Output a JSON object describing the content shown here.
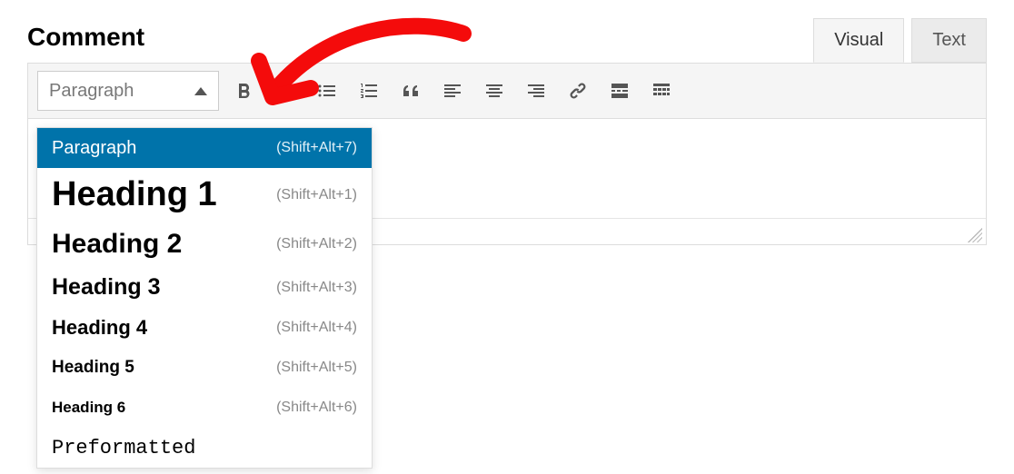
{
  "title": "Comment",
  "tabs": {
    "visual": "Visual",
    "text": "Text"
  },
  "format_selector": {
    "current": "Paragraph"
  },
  "toolbar_icons": {
    "bold": "bold-icon",
    "italic": "italic-icon",
    "ul": "bullet-list-icon",
    "ol": "numbered-list-icon",
    "quote": "blockquote-icon",
    "align_left": "align-left-icon",
    "align_center": "align-center-icon",
    "align_right": "align-right-icon",
    "link": "link-icon",
    "readmore": "read-more-icon",
    "toolbar_toggle": "toolbar-toggle-icon"
  },
  "dropdown": {
    "items": [
      {
        "label": "Paragraph",
        "shortcut": "(Shift+Alt+7)",
        "cls": "dd-paragraph",
        "selected": true,
        "name": "format-option-paragraph"
      },
      {
        "label": "Heading 1",
        "shortcut": "(Shift+Alt+1)",
        "cls": "dd-h1",
        "selected": false,
        "name": "format-option-heading-1"
      },
      {
        "label": "Heading 2",
        "shortcut": "(Shift+Alt+2)",
        "cls": "dd-h2",
        "selected": false,
        "name": "format-option-heading-2"
      },
      {
        "label": "Heading 3",
        "shortcut": "(Shift+Alt+3)",
        "cls": "dd-h3",
        "selected": false,
        "name": "format-option-heading-3"
      },
      {
        "label": "Heading 4",
        "shortcut": "(Shift+Alt+4)",
        "cls": "dd-h4",
        "selected": false,
        "name": "format-option-heading-4"
      },
      {
        "label": "Heading 5",
        "shortcut": "(Shift+Alt+5)",
        "cls": "dd-h5",
        "selected": false,
        "name": "format-option-heading-5"
      },
      {
        "label": "Heading 6",
        "shortcut": "(Shift+Alt+6)",
        "cls": "dd-h6",
        "selected": false,
        "name": "format-option-heading-6"
      },
      {
        "label": "Preformatted",
        "shortcut": "",
        "cls": "dd-pre",
        "selected": false,
        "name": "format-option-preformatted"
      }
    ]
  }
}
